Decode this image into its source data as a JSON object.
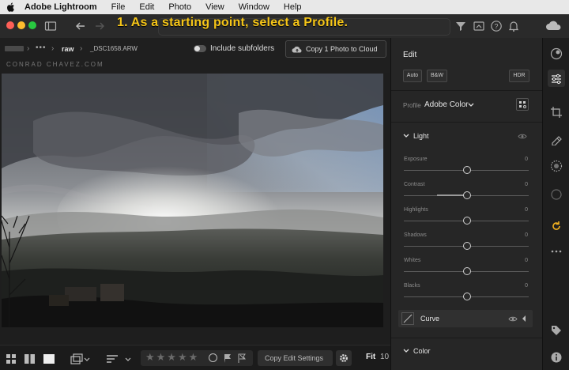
{
  "menubar": {
    "apple_icon": "apple-icon",
    "app_name": "Adobe Lightroom",
    "items": [
      "File",
      "Edit",
      "Photo",
      "View",
      "Window",
      "Help"
    ]
  },
  "caption": "1. As a starting point, select a Profile.",
  "breadcrumb": {
    "folder": "raw",
    "file": "_DSC1658.ARW"
  },
  "include_subfolders_label": "Include subfolders",
  "copy_cloud_label": "Copy 1 Photo to Cloud",
  "watermark": "CONRAD CHAVEZ.COM",
  "bottombar": {
    "copy_edit_label": "Copy Edit Settings",
    "zoom_fit": "Fit",
    "zoom_value": "10"
  },
  "edit_panel": {
    "title": "Edit",
    "buttons": {
      "auto": "Auto",
      "bw": "B&W",
      "hdr": "HDR"
    },
    "profile_label": "Profile",
    "profile_value": "Adobe Color",
    "light_section": "Light",
    "sliders": [
      {
        "label": "Exposure",
        "value": "0"
      },
      {
        "label": "Contrast",
        "value": "0"
      },
      {
        "label": "Highlights",
        "value": "0"
      },
      {
        "label": "Shadows",
        "value": "0"
      },
      {
        "label": "Whites",
        "value": "0"
      },
      {
        "label": "Blacks",
        "value": "0"
      }
    ],
    "curve_label": "Curve",
    "color_section": "Color"
  },
  "colors": {
    "caption": "#f5c518",
    "close": "#fe5f57",
    "minimize": "#febc2e",
    "zoom": "#28c840",
    "accent": "#f0b020"
  }
}
